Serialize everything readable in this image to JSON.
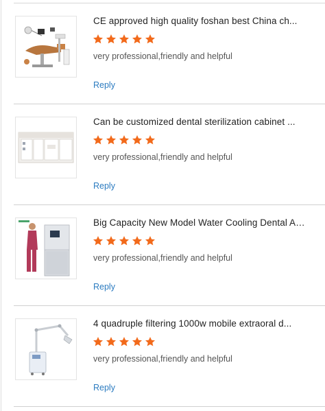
{
  "reviews": [
    {
      "title": "CE approved high quality foshan best China ch...",
      "rating": 5,
      "comment": "very professional,friendly and helpful",
      "reply_label": "Reply",
      "image": "dental-chair"
    },
    {
      "title": "Can be customized dental sterilization cabinet ...",
      "rating": 5,
      "comment": "very professional,friendly and helpful",
      "reply_label": "Reply",
      "image": "sterilization-cabinet"
    },
    {
      "title": "Big Capacity New Model Water Cooling Dental Autocl...",
      "rating": 5,
      "comment": "very professional,friendly and helpful",
      "reply_label": "Reply",
      "image": "autoclave-with-person"
    },
    {
      "title": "4 quadruple filtering 1000w mobile extraoral d...",
      "rating": 5,
      "comment": "very professional,friendly and helpful",
      "reply_label": "Reply",
      "image": "extraoral-suction-unit"
    }
  ],
  "colors": {
    "star": "#f26a1b",
    "reply_link": "#2b7bc0",
    "divider": "#d0d0d0"
  },
  "icons": {
    "rating": "star-icon"
  }
}
